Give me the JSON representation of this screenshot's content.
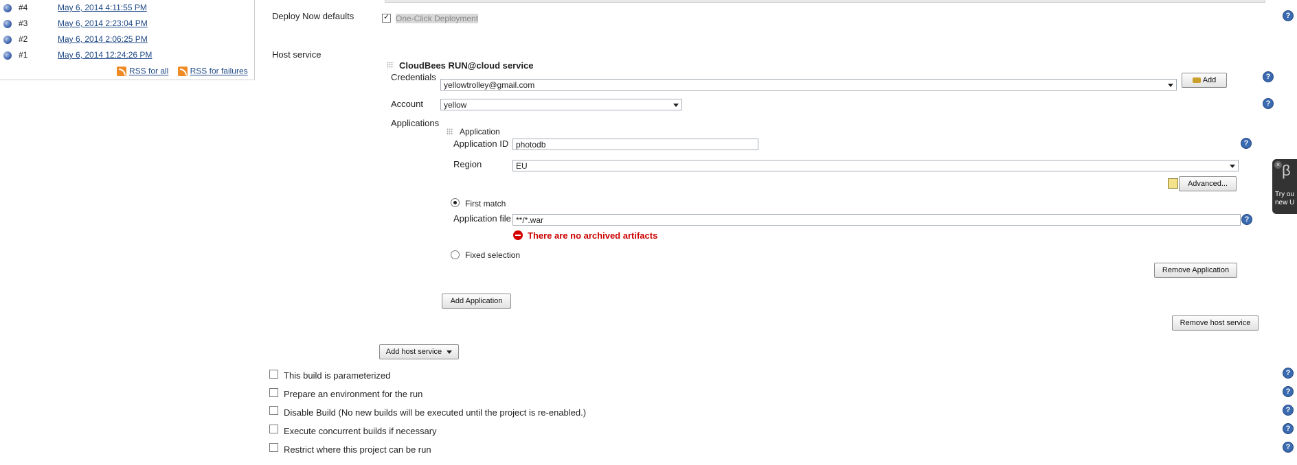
{
  "history": {
    "builds": [
      {
        "number": "#4",
        "date": "May 6, 2014 4:11:55 PM"
      },
      {
        "number": "#3",
        "date": "May 6, 2014 2:23:04 PM"
      },
      {
        "number": "#2",
        "date": "May 6, 2014 2:06:25 PM"
      },
      {
        "number": "#1",
        "date": "May 6, 2014 12:24:26 PM"
      }
    ],
    "rss_all": "RSS for all",
    "rss_failures": "RSS for failures"
  },
  "deploy": {
    "label": "Deploy Now defaults",
    "checkbox_label": "One-Click Deployment"
  },
  "host": {
    "label": "Host service",
    "service_title": "CloudBees RUN@cloud service",
    "credentials_label": "Credentials",
    "credentials_value": "yellowtrolley@gmail.com",
    "add_label": "Add",
    "account_label": "Account",
    "account_value": "yellow",
    "applications_label": "Applications",
    "application_title": "Application",
    "app_id_label": "Application ID",
    "app_id_value": "photodb",
    "region_label": "Region",
    "region_value": "EU",
    "advanced_label": "Advanced...",
    "first_match_label": "First match",
    "app_file_label": "Application file",
    "app_file_value": "**/*.war",
    "error_text": "There are no archived artifacts",
    "fixed_selection_label": "Fixed selection",
    "remove_app_label": "Remove Application",
    "add_app_label": "Add Application",
    "remove_host_label": "Remove host service",
    "add_host_label": "Add host service"
  },
  "options": [
    "This build is parameterized",
    "Prepare an environment for the run",
    "Disable Build (No new builds will be executed until the project is re-enabled.)",
    "Execute concurrent builds if necessary",
    "Restrict where this project can be run"
  ],
  "beta": {
    "symbol": "β",
    "line1": "Try ou",
    "line2": "new U"
  },
  "icons": {
    "help": "?"
  },
  "colors": {
    "link": "#204a87",
    "error": "#cc0000",
    "help": "#3a6ab0"
  }
}
